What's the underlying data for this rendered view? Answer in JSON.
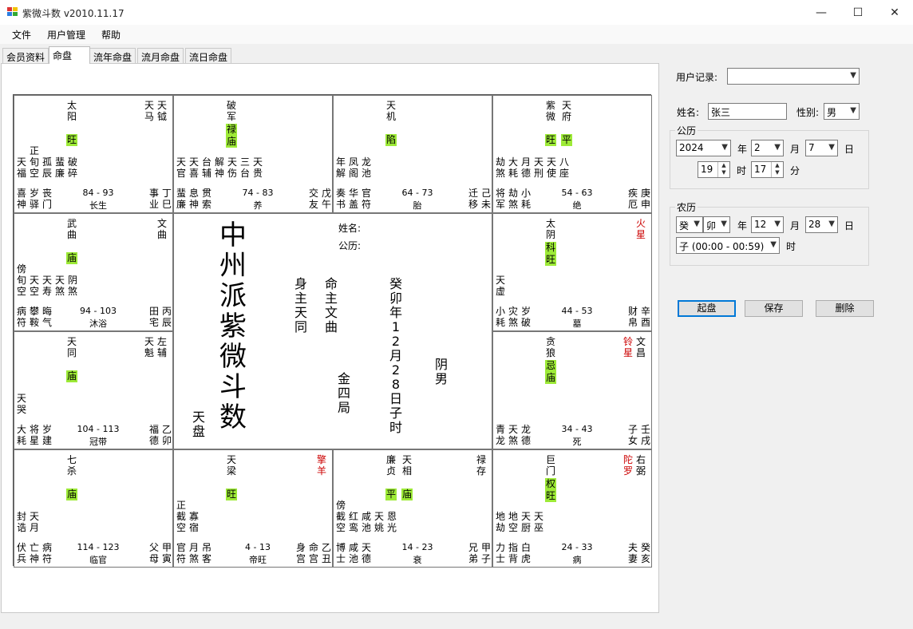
{
  "window": {
    "title": "紫微斗数 v2010.11.17",
    "minimize": "—",
    "maximize": "☐",
    "close": "✕"
  },
  "menu": [
    "文件",
    "用户管理",
    "帮助"
  ],
  "tabs": [
    "会员资料",
    "命盘",
    "流年命盘",
    "流月命盘",
    "流日命盘"
  ],
  "active_tab": "命盘",
  "palaces": [
    {
      "name": "巳",
      "main": [
        {
          "t": "太阳"
        }
      ],
      "badges": [
        "旺"
      ],
      "aux": [
        {
          "t": "天马"
        },
        {
          "t": "天钺"
        }
      ],
      "minor": [
        "天福",
        "正旬空",
        "孤辰",
        "蜚廉",
        "破碎"
      ],
      "bottom": [
        "喜神",
        "岁驿",
        "丧门"
      ],
      "range": "84 - 93",
      "stage": "长生",
      "br": [
        "事业",
        "丁巳"
      ]
    },
    {
      "name": "午",
      "main": [
        {
          "t": "破军"
        }
      ],
      "badges": [
        "禄",
        "庙"
      ],
      "aux": [],
      "minor": [
        "天官",
        "天喜",
        "台辅",
        "解神",
        "天伤",
        "三台",
        "天贵"
      ],
      "bottom": [
        "蜚廉",
        "息神",
        "贯索"
      ],
      "range": "74 - 83",
      "stage": "养",
      "br": [
        "交友",
        "戊午"
      ]
    },
    {
      "name": "未",
      "main": [
        {
          "t": "天机"
        }
      ],
      "badges": [
        "陷"
      ],
      "aux": [],
      "minor": [
        "年解",
        "凤阁",
        "龙池"
      ],
      "bottom": [
        "奏书",
        "华盖",
        "官符"
      ],
      "range": "64 - 73",
      "stage": "胎",
      "br": [
        "迁移",
        "己未"
      ]
    },
    {
      "name": "申",
      "main": [
        {
          "t": "紫微"
        },
        {
          "t": "天府"
        }
      ],
      "badges": [
        "旺",
        "平"
      ],
      "aux": [],
      "minor": [
        "劫煞",
        "大耗",
        "月德",
        "天刑",
        "天使",
        "八座"
      ],
      "bottom": [
        "将军",
        "劫煞",
        "小耗"
      ],
      "range": "54 - 63",
      "stage": "绝",
      "br": [
        "疾厄",
        "庚申"
      ]
    },
    {
      "name": "辰",
      "main": [
        {
          "t": "武曲"
        }
      ],
      "badges": [
        "庙"
      ],
      "aux": [
        {
          "t": "文曲"
        }
      ],
      "minor": [
        "傍旬空",
        "天空",
        "天寿",
        "天煞",
        "阴煞"
      ],
      "bottom": [
        "病符",
        "攀鞍",
        "晦气"
      ],
      "range": "94 - 103",
      "stage": "沐浴",
      "br": [
        "田宅",
        "丙辰"
      ]
    },
    {
      "name": "酉",
      "main": [
        {
          "t": "太阴"
        }
      ],
      "badges": [
        "科",
        "旺"
      ],
      "aux": [
        {
          "t": "火星",
          "red": true
        }
      ],
      "minor": [
        "天虚"
      ],
      "bottom": [
        "小耗",
        "灾煞",
        "岁破"
      ],
      "range": "44 - 53",
      "stage": "墓",
      "br": [
        "财帛",
        "辛酉"
      ]
    },
    {
      "name": "卯",
      "main": [
        {
          "t": "天同"
        }
      ],
      "badges": [
        "庙"
      ],
      "aux": [
        {
          "t": "天魁"
        },
        {
          "t": "左辅"
        }
      ],
      "minor": [
        "天哭"
      ],
      "bottom": [
        "大耗",
        "将星",
        "岁建"
      ],
      "range": "104 - 113",
      "stage": "冠带",
      "br": [
        "福德",
        "乙卯"
      ]
    },
    {
      "name": "戌",
      "main": [
        {
          "t": "贪狼"
        }
      ],
      "badges": [
        "忌",
        "庙"
      ],
      "aux": [
        {
          "t": "铃星",
          "red": true
        },
        {
          "t": "文昌"
        }
      ],
      "minor": [],
      "bottom": [
        "青龙",
        "天煞",
        "龙德"
      ],
      "range": "34 - 43",
      "stage": "死",
      "br": [
        "子女",
        "壬戌"
      ]
    },
    {
      "name": "寅",
      "main": [
        {
          "t": "七杀"
        }
      ],
      "badges": [
        "庙"
      ],
      "aux": [],
      "minor": [
        "封诰",
        "天月"
      ],
      "bottom": [
        "伏兵",
        "亡神",
        "病符"
      ],
      "range": "114 - 123",
      "stage": "临官",
      "br": [
        "父母",
        "甲寅"
      ]
    },
    {
      "name": "丑",
      "main": [
        {
          "t": "天梁"
        }
      ],
      "badges": [
        "旺"
      ],
      "aux": [
        {
          "t": "擎羊",
          "red": true
        }
      ],
      "minor": [
        "正截空",
        "寡宿"
      ],
      "bottom": [
        "官符",
        "月煞",
        "吊客"
      ],
      "range": "4 - 13",
      "stage": "帝旺",
      "br": [
        "身宫",
        "命宫",
        "乙丑"
      ]
    },
    {
      "name": "子",
      "main": [
        {
          "t": "廉贞"
        },
        {
          "t": "天相"
        }
      ],
      "badges": [
        "平",
        "庙"
      ],
      "aux": [
        {
          "t": "禄存"
        }
      ],
      "minor": [
        "傍截空",
        "红鸾",
        "咸池",
        "天姚",
        "恩光"
      ],
      "bottom": [
        "博士",
        "咸池",
        "天德"
      ],
      "range": "14 - 23",
      "stage": "衰",
      "br": [
        "兄弟",
        "甲子"
      ]
    },
    {
      "name": "亥",
      "main": [
        {
          "t": "巨门"
        }
      ],
      "badges": [
        "权",
        "旺"
      ],
      "aux": [
        {
          "t": "陀罗",
          "red": true
        },
        {
          "t": "右弼"
        }
      ],
      "minor": [
        "地劫",
        "地空",
        "天厨",
        "天巫"
      ],
      "bottom": [
        "力士",
        "指背",
        "白虎"
      ],
      "range": "24 - 33",
      "stage": "病",
      "br": [
        "夫妻",
        "癸亥"
      ]
    }
  ],
  "center": {
    "title": "中州派紫微斗数",
    "name_label": "姓名:",
    "date_label": "公历:",
    "body_master": "身主天同",
    "life_master": "命主文曲",
    "lunar": "癸卯年12月28日子时",
    "gender": "阴男",
    "element": "金四局",
    "panel_type": "天盘"
  },
  "right": {
    "user_record_label": "用户记录:",
    "user_record_value": "",
    "name_label": "姓名:",
    "name_value": "张三",
    "gender_label": "性别:",
    "gender_value": "男",
    "solar_group": "公历",
    "solar_year": "2024",
    "year_unit": "年",
    "solar_month": "2",
    "month_unit": "月",
    "solar_day": "7",
    "day_unit": "日",
    "solar_hour": "19",
    "hour_unit": "时",
    "solar_minute": "17",
    "minute_unit": "分",
    "lunar_group": "农历",
    "lunar_stem": "癸",
    "lunar_branch": "卯",
    "lunar_month": "12",
    "lunar_day": "28",
    "lunar_hour": "子 (00:00 - 00:59)",
    "lunar_hour_unit": "时",
    "btn_start": "起盘",
    "btn_save": "保存",
    "btn_delete": "删除"
  },
  "colors": {
    "badge": "#9dea37",
    "red_star": "#cc0000",
    "accent": "#0078d7"
  }
}
